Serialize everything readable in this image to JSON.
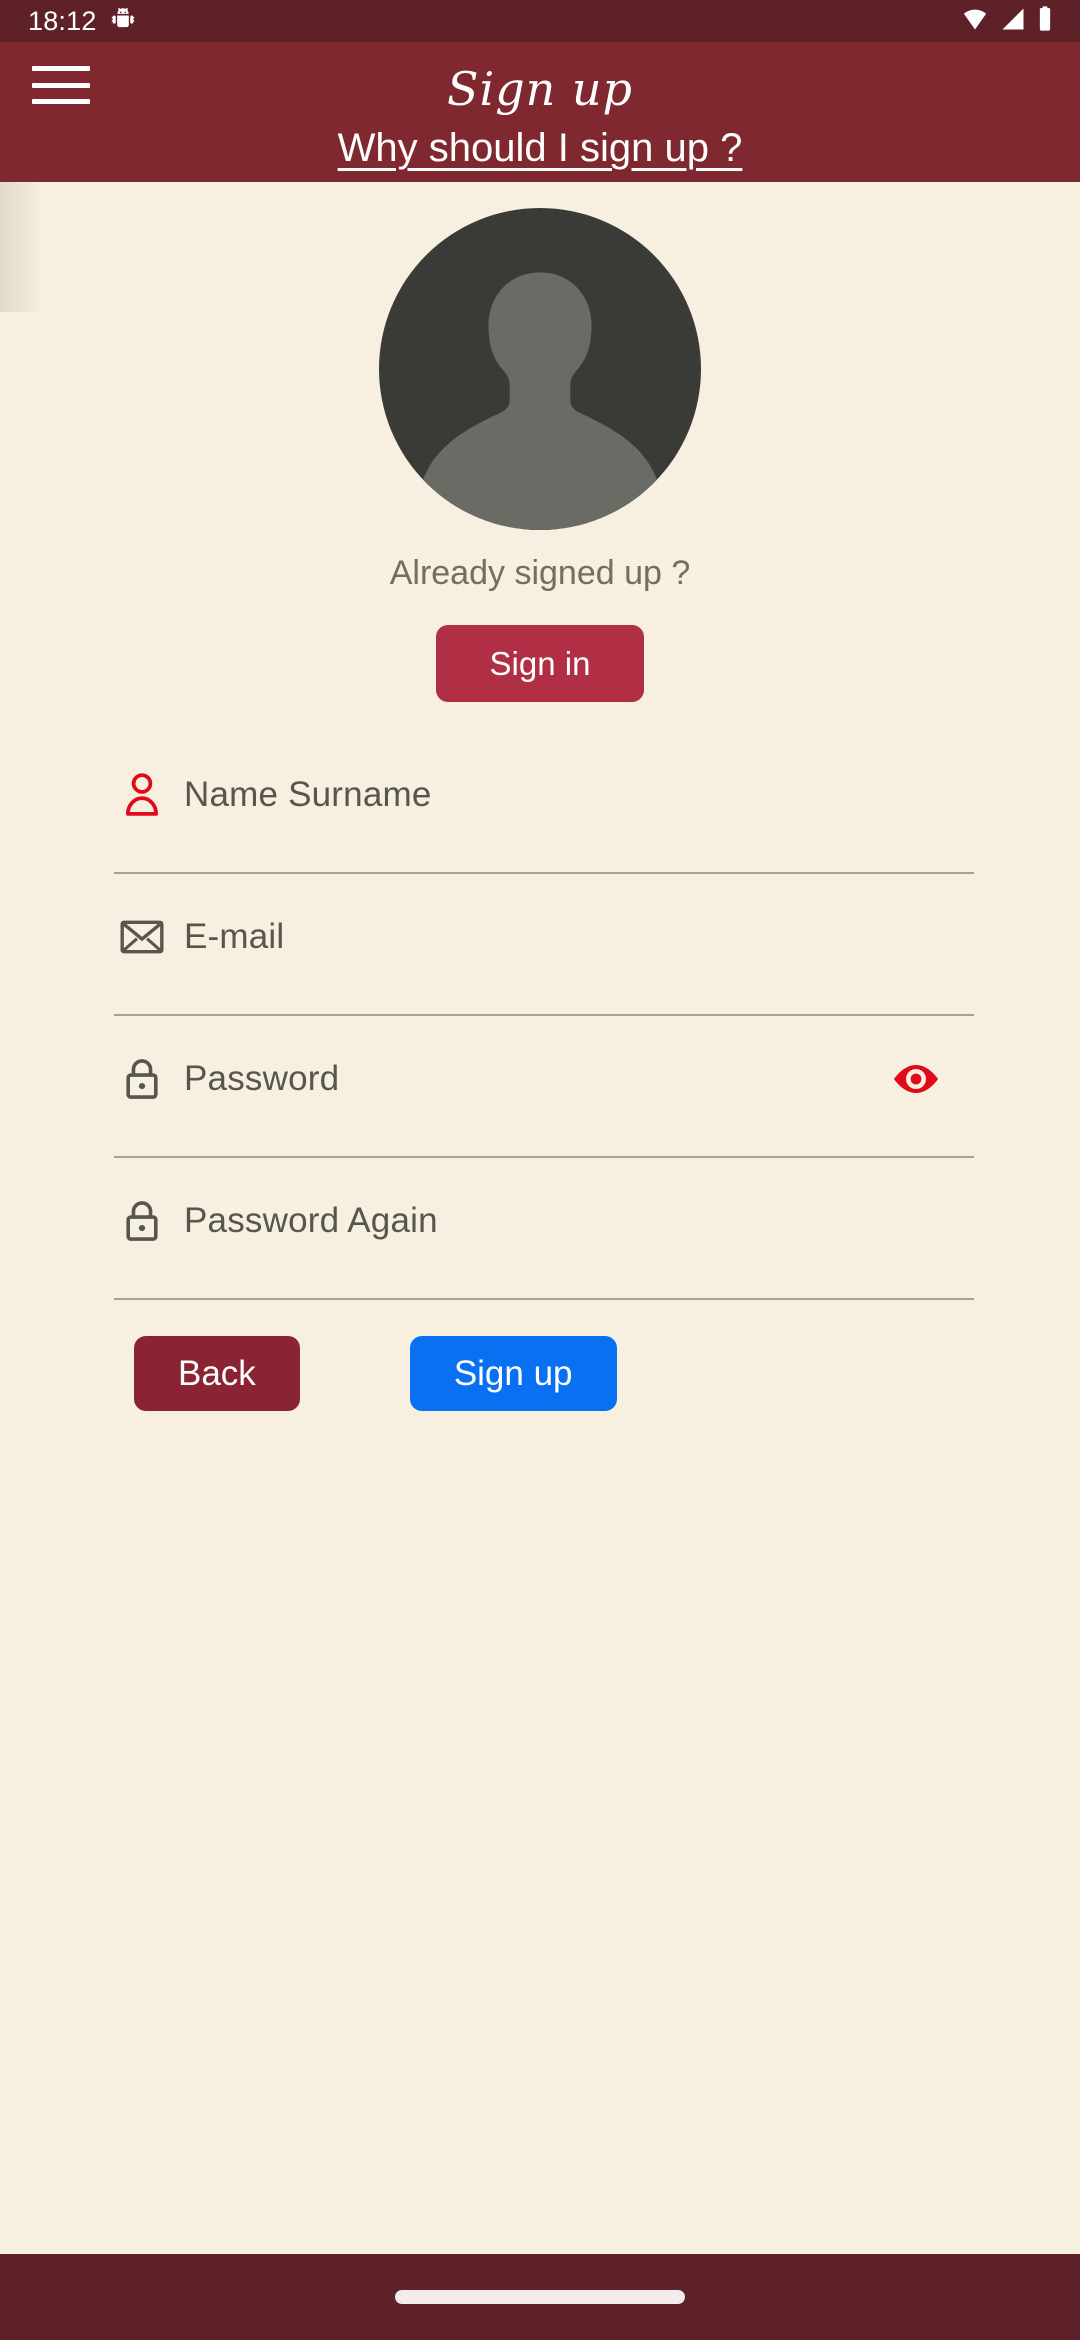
{
  "status_bar": {
    "time": "18:12",
    "icons": [
      "android-debug-icon",
      "wifi-icon",
      "cellular-signal-icon",
      "battery-icon"
    ]
  },
  "app_bar": {
    "menu_icon": "hamburger-menu-icon",
    "title": "Sign up",
    "subtitle_link": "Why should I sign up ?",
    "background_color": "#802830"
  },
  "profile": {
    "avatar_icon": "default-person-avatar",
    "already_signed_up_text": "Already signed up ?",
    "sign_in_label": "Sign in",
    "sign_in_color": "#b02f44"
  },
  "form": {
    "fields": [
      {
        "name": "name-surname",
        "icon": "person-icon",
        "icon_color": "#e00a18",
        "placeholder": "Name Surname",
        "value": ""
      },
      {
        "name": "email",
        "icon": "envelope-icon",
        "icon_color": "#57564d",
        "placeholder": "E-mail",
        "value": ""
      },
      {
        "name": "password",
        "icon": "lock-icon",
        "icon_color": "#57564d",
        "placeholder": "Password",
        "value": "",
        "toggle_icon": "eye-visibility-icon",
        "toggle_color": "#e00a18"
      },
      {
        "name": "password-again",
        "icon": "lock-icon",
        "icon_color": "#57564d",
        "placeholder": "Password Again",
        "value": ""
      }
    ]
  },
  "actions": {
    "back_label": "Back",
    "back_color": "#8a2433",
    "sign_up_label": "Sign up",
    "sign_up_color": "#0a70f2"
  },
  "nav_bar": {
    "gesture_pill": "home-gesture-pill",
    "background_color": "#5e2127"
  },
  "theme": {
    "page_background": "#f7efdf",
    "text_color": "#57564d",
    "muted_text_color": "#6f6f62",
    "underline_color": "#a9a391"
  }
}
